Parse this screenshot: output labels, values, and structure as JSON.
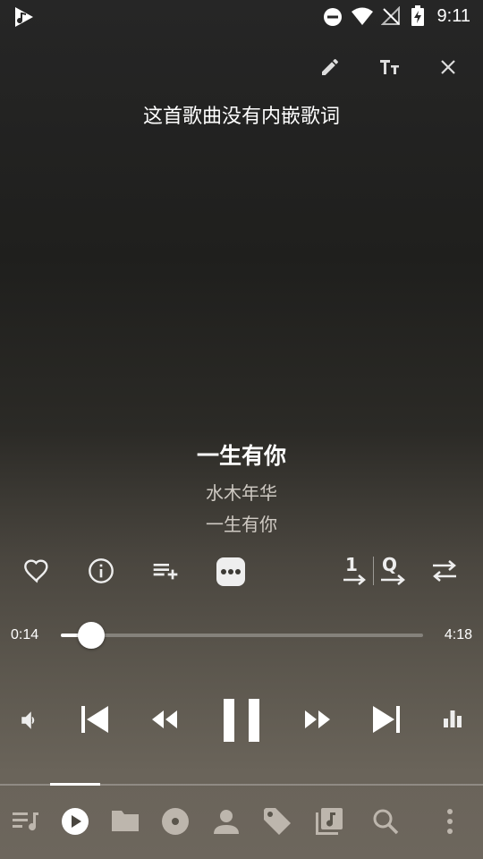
{
  "status_bar": {
    "time": "9:11"
  },
  "lyrics": {
    "text": "这首歌曲没有内嵌歌词"
  },
  "song": {
    "title": "一生有你",
    "artist": "水木年华",
    "album": "一生有你"
  },
  "progress": {
    "elapsed": "0:14",
    "total": "4:18",
    "fraction": 0.054
  },
  "colors": {
    "accent": "#ffffff",
    "secondary_text": "#cfcac3"
  },
  "icons": {
    "top_actions": [
      "edit-icon",
      "text-size-icon",
      "close-icon"
    ],
    "song_actions": [
      "heart-icon",
      "info-icon",
      "add-to-playlist-icon",
      "more-icon"
    ],
    "play_modes": [
      "play-order-1-icon",
      "play-order-q-icon",
      "repeat-icon"
    ],
    "playback": [
      "volume-icon",
      "skip-previous-icon",
      "rewind-icon",
      "pause-icon",
      "fast-forward-icon",
      "skip-next-icon",
      "equalizer-icon"
    ],
    "bottom_nav": [
      "queue-icon",
      "now-playing-icon",
      "folder-icon",
      "album-icon",
      "artist-icon",
      "tag-icon",
      "library-icon",
      "search-icon",
      "overflow-menu-icon"
    ]
  },
  "bottom_nav": {
    "selected_index": 1
  }
}
